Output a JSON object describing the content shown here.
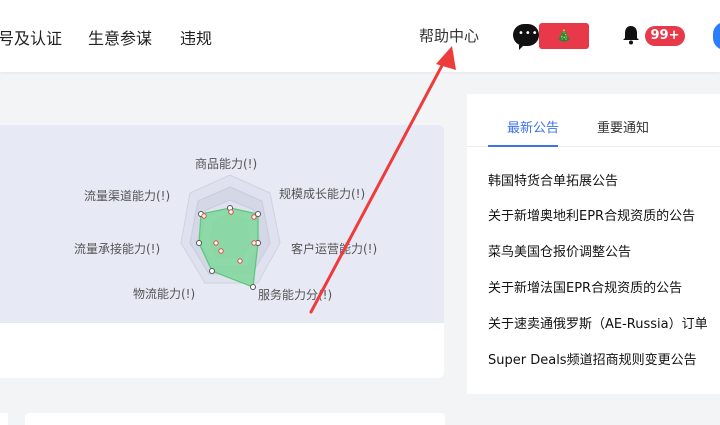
{
  "nav": {
    "items": [
      "号及认证",
      "生意参谋",
      "违规"
    ],
    "help": "帮助中心",
    "red_badge_text": "🎄",
    "notification_count": "99+"
  },
  "radar": {
    "labels": {
      "product": "商品能力(!)",
      "growth": "规模成长能力(!)",
      "customer": "客户运营能力(!)",
      "service": "服务能力分(!)",
      "logistics": "物流能力(!)",
      "traffic_conv": "流量承接能力(!)",
      "traffic_channel": "流量渠道能力(!)"
    }
  },
  "notices": {
    "tabs": [
      "最新公告",
      "重要通知"
    ],
    "items": [
      "韩国特货合单拓展公告",
      "关于新增奥地利EPR合规资质的公告",
      "菜鸟美国仓报价调整公告",
      "关于新增法国EPR合规资质的公告",
      "关于速卖通俄罗斯（AE-Russia）订单",
      "Super Deals频道招商规则变更公告"
    ]
  },
  "colors": {
    "accent": "#3c74e8",
    "badge_red": "#e8394a",
    "radar_fill": "#7fd79a",
    "annotation_arrow": "#ee3b3b"
  }
}
